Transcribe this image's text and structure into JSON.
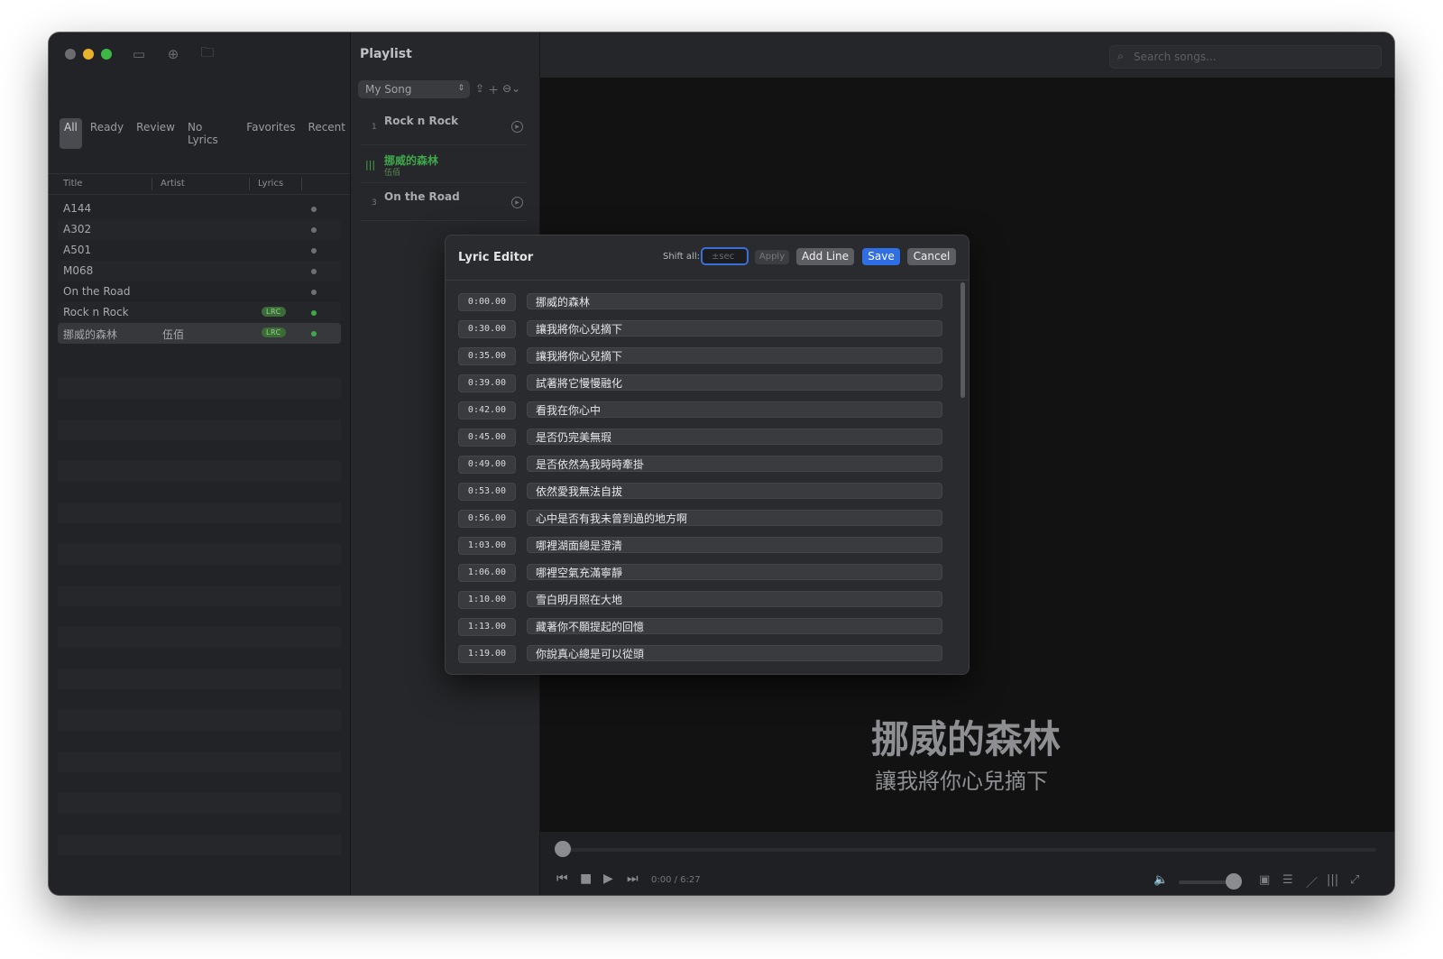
{
  "sidebar": {
    "filters": [
      "All",
      "Ready",
      "Review",
      "No Lyrics",
      "Favorites",
      "Recent"
    ],
    "columns": {
      "title": "Title",
      "artist": "Artist",
      "lyrics": "Lyrics"
    },
    "songs": [
      {
        "title": "A144",
        "artist": "",
        "badge": ""
      },
      {
        "title": "A302",
        "artist": "",
        "badge": ""
      },
      {
        "title": "A501",
        "artist": "",
        "badge": ""
      },
      {
        "title": "M068",
        "artist": "",
        "badge": ""
      },
      {
        "title": "On the Road",
        "artist": "",
        "badge": ""
      },
      {
        "title": "Rock n Rock",
        "artist": "",
        "badge": "LRC"
      },
      {
        "title": "挪威的森林",
        "artist": "伍佰",
        "badge": "LRC"
      }
    ]
  },
  "playlist": {
    "title": "Playlist",
    "selected": "My Song",
    "items": [
      {
        "num": "1",
        "name": "Rock n Rock",
        "sub": ""
      },
      {
        "num": "",
        "name": "挪威的森林",
        "sub": "伍佰"
      },
      {
        "num": "3",
        "name": "On the Road",
        "sub": ""
      }
    ]
  },
  "search": {
    "placeholder": "Search songs..."
  },
  "now_playing": {
    "line1": "挪威的森林",
    "line2": "讓我將你心兒摘下"
  },
  "transport": {
    "time": "0:00 / 6:27"
  },
  "lyric_editor": {
    "title": "Lyric Editor",
    "shift_label": "Shift all:",
    "shift_placeholder": "±sec",
    "apply": "Apply",
    "add_line": "Add Line",
    "save": "Save",
    "cancel": "Cancel",
    "lines": [
      {
        "time": "0:00.00",
        "text": "挪威的森林"
      },
      {
        "time": "0:30.00",
        "text": "讓我將你心兒摘下"
      },
      {
        "time": "0:35.00",
        "text": "讓我將你心兒摘下"
      },
      {
        "time": "0:39.00",
        "text": "試著將它慢慢融化"
      },
      {
        "time": "0:42.00",
        "text": "看我在你心中"
      },
      {
        "time": "0:45.00",
        "text": "是否仍完美無瑕"
      },
      {
        "time": "0:49.00",
        "text": "是否依然為我時時牽掛"
      },
      {
        "time": "0:53.00",
        "text": "依然愛我無法自拔"
      },
      {
        "time": "0:56.00",
        "text": "心中是否有我未曾到過的地方啊"
      },
      {
        "time": "1:03.00",
        "text": "哪裡湖面總是澄清"
      },
      {
        "time": "1:06.00",
        "text": "哪裡空氣充滿寧靜"
      },
      {
        "time": "1:10.00",
        "text": "雪白明月照在大地"
      },
      {
        "time": "1:13.00",
        "text": "藏著你不願提起的回憶"
      },
      {
        "time": "1:19.00",
        "text": "你說真心總是可以從頭"
      }
    ]
  },
  "colors": {
    "accent": "#2f6fe3",
    "playing": "#3ea84a",
    "lrc_badge": "#3d6b37"
  }
}
